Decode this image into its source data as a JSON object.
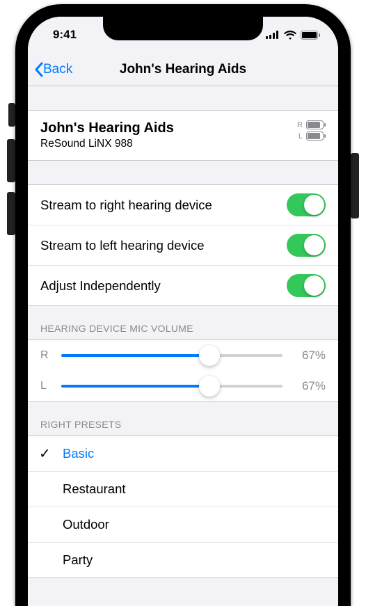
{
  "status": {
    "time": "9:41"
  },
  "nav": {
    "back_label": "Back",
    "title": "John's Hearing Aids"
  },
  "device": {
    "name": "John's Hearing Aids",
    "model": "ReSound LiNX 988",
    "battery_right_label": "R",
    "battery_left_label": "L",
    "battery_right_level": 0.85,
    "battery_left_level": 0.85
  },
  "toggles": {
    "stream_right_label": "Stream to right hearing device",
    "stream_right_on": true,
    "stream_left_label": "Stream to left hearing device",
    "stream_left_on": true,
    "adjust_independent_label": "Adjust Independently",
    "adjust_independent_on": true
  },
  "mic_volume": {
    "header": "Hearing Device Mic Volume",
    "right_label": "R",
    "right_value": 67,
    "right_display": "67%",
    "left_label": "L",
    "left_value": 67,
    "left_display": "67%"
  },
  "presets": {
    "header": "Right Presets",
    "items": [
      {
        "label": "Basic",
        "selected": true
      },
      {
        "label": "Restaurant",
        "selected": false
      },
      {
        "label": "Outdoor",
        "selected": false
      },
      {
        "label": "Party",
        "selected": false
      }
    ]
  }
}
